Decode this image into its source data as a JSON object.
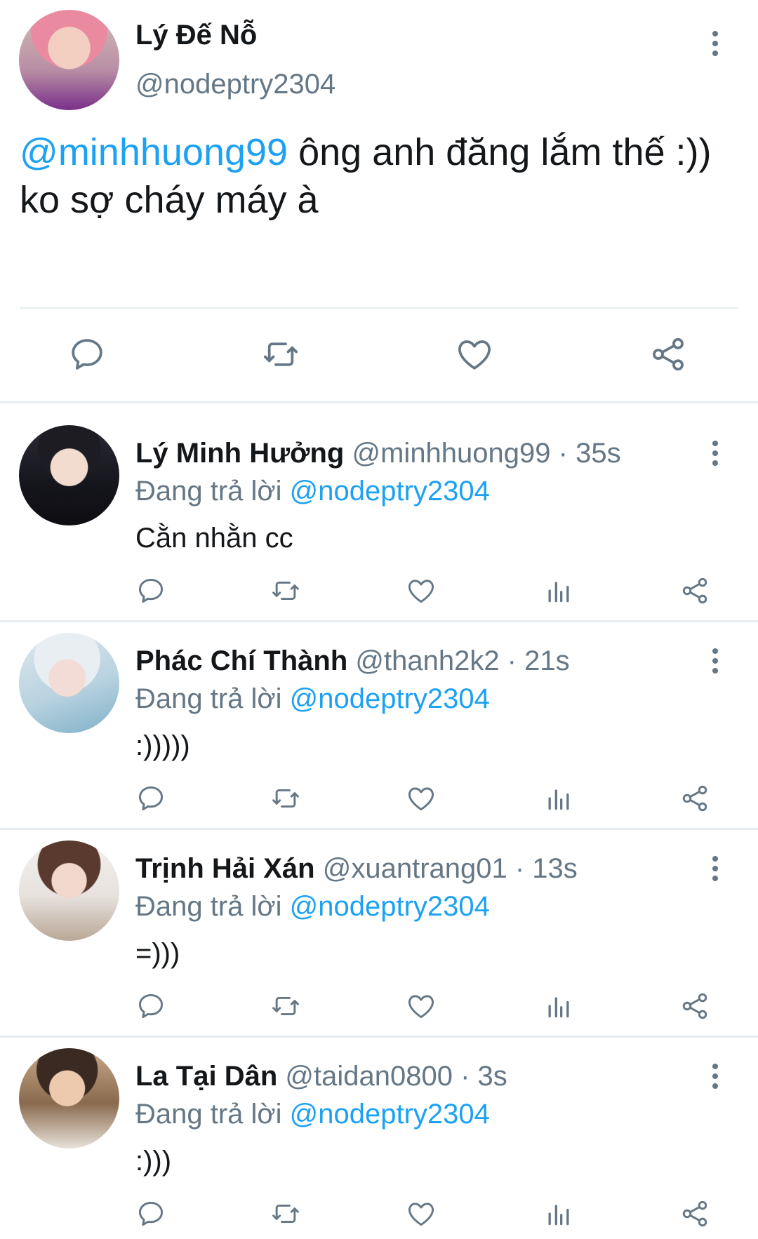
{
  "main_tweet": {
    "name": "Lý Đế Nỗ",
    "handle": "@nodeptry2304",
    "mention": "@minhhuong99",
    "text": " ông anh đăng lắm thế :)) ko sợ cháy máy à",
    "actions": [
      "reply-icon",
      "retweet-icon",
      "like-icon",
      "share-icon"
    ]
  },
  "replies": [
    {
      "name": "Lý Minh Hưởng",
      "meta": "@minhhuong99 · 35s",
      "replying_prefix": "Đang trả lời ",
      "replying_to": "@nodeptry2304",
      "text": "Cằn nhằn cc"
    },
    {
      "name": "Phác Chí Thành",
      "meta": "@thanh2k2 · 21s",
      "replying_prefix": "Đang trả lời ",
      "replying_to": "@nodeptry2304",
      "text": ":)))))"
    },
    {
      "name": "Trịnh Hải Xán",
      "meta": "@xuantrang01 · 13s",
      "replying_prefix": "Đang trả lời ",
      "replying_to": "@nodeptry2304",
      "text": "=)))"
    },
    {
      "name": "La Tại Dân",
      "meta": "@taidan0800 · 3s",
      "replying_prefix": "Đang trả lời ",
      "replying_to": "@nodeptry2304",
      "text": ":)))"
    }
  ],
  "colors": {
    "accent": "#1da1f2",
    "secondary_text": "#657786",
    "primary_text": "#14171a",
    "divider": "#e6ecf0"
  }
}
